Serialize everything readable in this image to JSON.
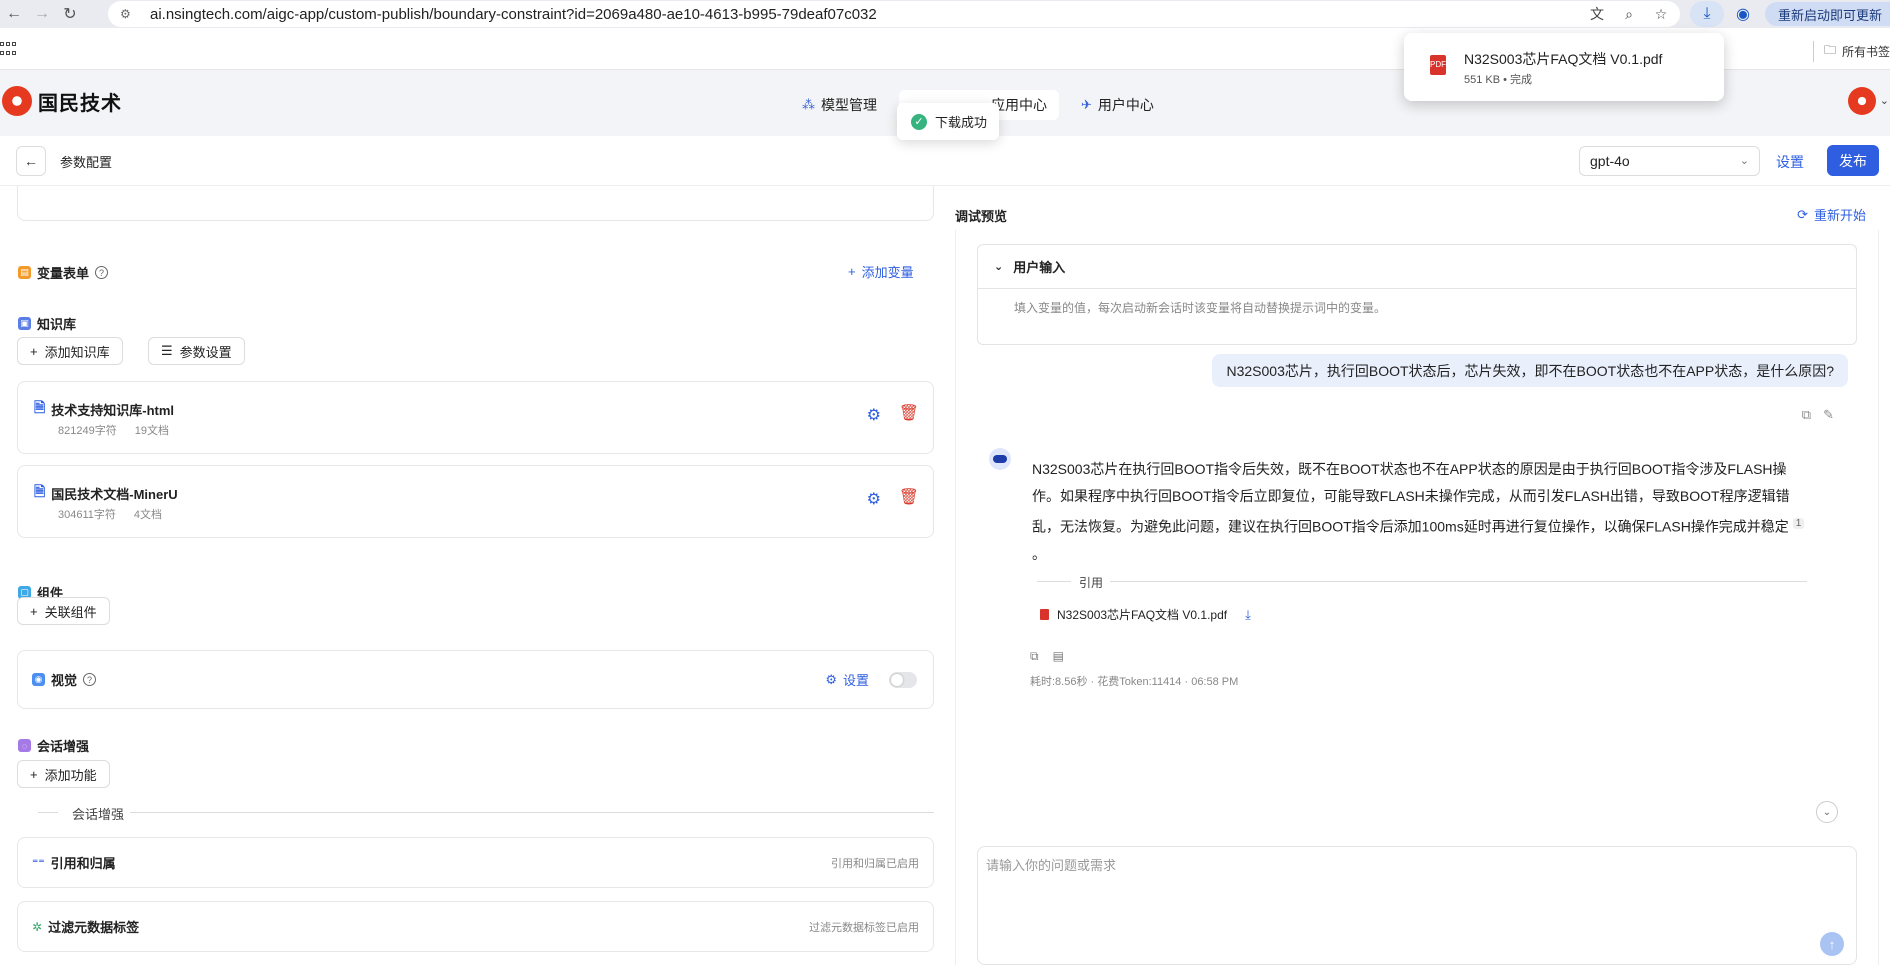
{
  "browser": {
    "url": "ai.nsingtech.com/aigc-app/custom-publish/boundary-constraint?id=2069a480-ae10-4613-b995-79deaf07c032",
    "update_label": "重新启动即可更新",
    "bookmarks_label": "所有书签"
  },
  "download": {
    "file_name": "N32S003芯片FAQ文档 V0.1.pdf",
    "meta": "551 KB • 完成"
  },
  "toast": {
    "text": "下载成功"
  },
  "header": {
    "brand": "国民技术",
    "nav": [
      {
        "label": "模型管理"
      },
      {
        "label": "应用中心"
      },
      {
        "label": "用户中心"
      }
    ]
  },
  "subbar": {
    "title": "参数配置",
    "model": "gpt-4o",
    "settings_label": "设置",
    "publish_label": "发布"
  },
  "left": {
    "variables": {
      "title": "变量表单",
      "add_label": "添加变量"
    },
    "knowledge": {
      "title": "知识库",
      "add_label": "添加知识库",
      "params_label": "参数设置",
      "items": [
        {
          "name": "技术支持知识库-html",
          "chars": "821249字符",
          "docs": "19文档"
        },
        {
          "name": "国民技术文档-MinerU",
          "chars": "304611字符",
          "docs": "4文档"
        }
      ]
    },
    "components": {
      "title": "组件",
      "link_label": "关联组件"
    },
    "vision": {
      "title": "视觉",
      "settings_label": "设置"
    },
    "enhance": {
      "title": "会话增强",
      "add_label": "添加功能",
      "divider_label": "会话增强",
      "items": [
        {
          "name": "引用和归属",
          "status": "引用和归属已启用"
        },
        {
          "name": "过滤元数据标签",
          "status": "过滤元数据标签已启用"
        }
      ]
    }
  },
  "right": {
    "title": "调试预览",
    "restart_label": "重新开始",
    "user_input": {
      "title": "用户输入",
      "hint": "填入变量的值，每次启动新会话时该变量将自动替换提示词中的变量。"
    },
    "user_message": "N32S003芯片，执行回BOOT状态后，芯片失效，即不在BOOT状态也不在APP状态，是什么原因?",
    "answer": {
      "text": "N32S003芯片在执行回BOOT指令后失效，既不在BOOT状态也不在APP状态的原因是由于执行回BOOT指令涉及FLASH操作。如果程序中执行回BOOT指令后立即复位，可能导致FLASH未操作完成，从而引发FLASH出错，导致BOOT程序逻辑错乱，无法恢复。为避免此问题，建议在执行回BOOT指令后添加100ms延时再进行复位操作，以确保FLASH操作完成并稳定",
      "citation": "1",
      "tail": "。",
      "ref_label": "引用",
      "ref_file": "N32S003芯片FAQ文档 V0.1.pdf",
      "meta": "耗时:8.56秒 · 花费Token:11414 · 06:58 PM"
    },
    "input_placeholder": "请输入你的问题或需求"
  },
  "colors": {
    "primary": "#2f5fe0",
    "danger": "#d93a2b",
    "brand": "#e53a1f"
  }
}
